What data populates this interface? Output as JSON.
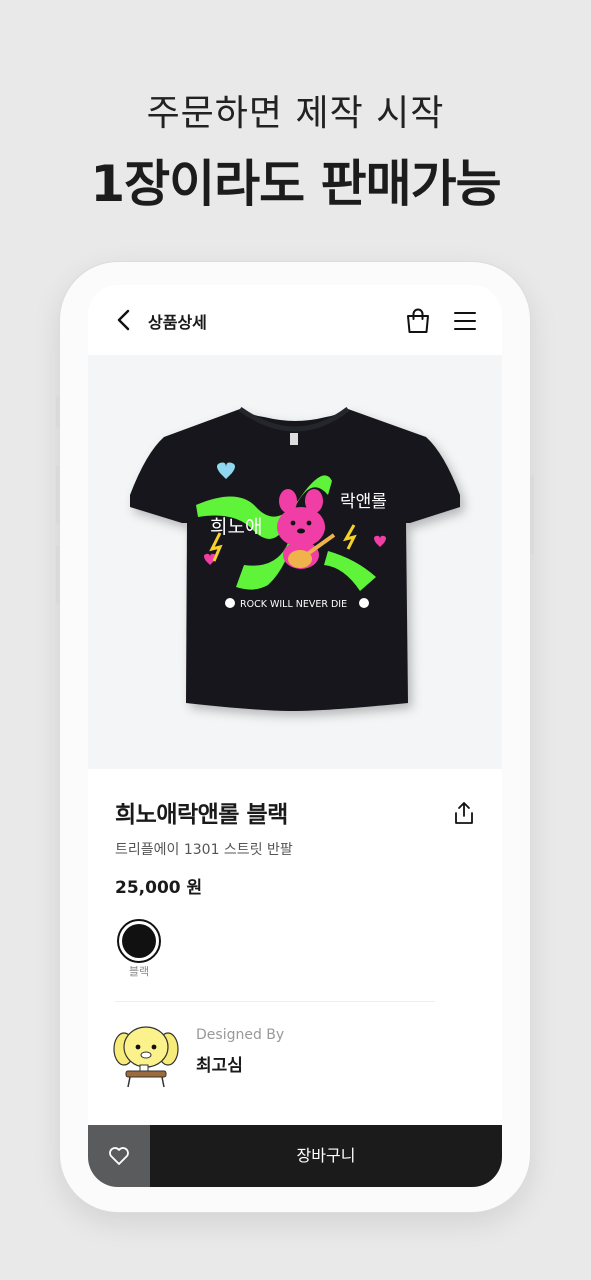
{
  "promo": {
    "subtitle": "주문하면 제작 시작",
    "title": "1장이라도 판매가능"
  },
  "header": {
    "title": "상품상세",
    "back_icon": "chevron-left-icon",
    "cart_icon": "shopping-bag-icon",
    "menu_icon": "hamburger-menu-icon"
  },
  "product": {
    "print_text_korean": "희노애락앤롤",
    "print_text_english": "ROCK WILL NEVER DIE",
    "name": "희노애락앤롤 블랙",
    "subtitle": "트리플에이 1301 스트릿 반팔",
    "price": "25,000 원",
    "share_icon": "share-icon"
  },
  "colors": {
    "selected": "블랙",
    "options": [
      {
        "label": "블랙",
        "hex": "#111111"
      }
    ]
  },
  "designer": {
    "label": "Designed By",
    "name": "최고심"
  },
  "actions": {
    "like_icon": "heart-outline-icon",
    "cart_label": "장바구니"
  },
  "theme": {
    "background": "#e9e9e9",
    "dark_button": "#1b1b1b",
    "like_button": "#595b5d",
    "print_green": "#5ff33a",
    "print_pink": "#f03ea6"
  }
}
